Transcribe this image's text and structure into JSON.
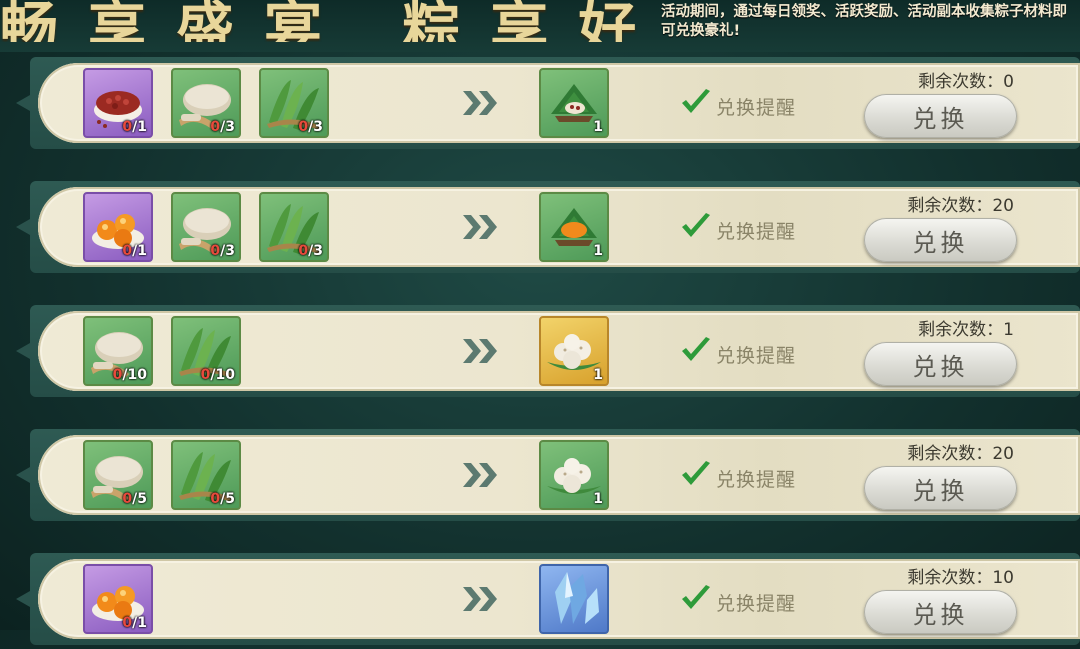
{
  "header": {
    "title": "畅享盛宴 粽享好礼",
    "description": "活动期间，通过每日领奖、活跃奖励、活动副本收集粽子材料即可兑换豪礼!"
  },
  "rows": [
    {
      "materials": [
        {
          "icon": "red-bean-bowl-icon",
          "rarity": "purple",
          "have": "0",
          "need": "1"
        },
        {
          "icon": "glutinous-rice-icon",
          "rarity": "green",
          "have": "0",
          "need": "3"
        },
        {
          "icon": "bamboo-leaves-icon",
          "rarity": "green",
          "have": "0",
          "need": "3"
        }
      ],
      "reward": {
        "icon": "red-bean-zongzi-icon",
        "rarity": "green",
        "count": "1"
      },
      "remind_label": "兑换提醒",
      "remaining": "剩余次数：0",
      "button_label": "兑换"
    },
    {
      "materials": [
        {
          "icon": "salted-egg-yolk-icon",
          "rarity": "purple",
          "have": "0",
          "need": "1"
        },
        {
          "icon": "glutinous-rice-icon",
          "rarity": "green",
          "have": "0",
          "need": "3"
        },
        {
          "icon": "bamboo-leaves-icon",
          "rarity": "green",
          "have": "0",
          "need": "3"
        }
      ],
      "reward": {
        "icon": "egg-yolk-zongzi-icon",
        "rarity": "green",
        "count": "1"
      },
      "remind_label": "兑换提醒",
      "remaining": "剩余次数：20",
      "button_label": "兑换"
    },
    {
      "materials": [
        {
          "icon": "glutinous-rice-icon",
          "rarity": "green",
          "have": "0",
          "need": "10"
        },
        {
          "icon": "bamboo-leaves-icon",
          "rarity": "green",
          "have": "0",
          "need": "10"
        }
      ],
      "reward": {
        "icon": "rice-dumplings-plate-icon",
        "rarity": "gold",
        "count": "1"
      },
      "remind_label": "兑换提醒",
      "remaining": "剩余次数：1",
      "button_label": "兑换"
    },
    {
      "materials": [
        {
          "icon": "glutinous-rice-icon",
          "rarity": "green",
          "have": "0",
          "need": "5"
        },
        {
          "icon": "bamboo-leaves-icon",
          "rarity": "green",
          "have": "0",
          "need": "5"
        }
      ],
      "reward": {
        "icon": "rice-dumplings-plate-icon",
        "rarity": "green",
        "count": "1"
      },
      "remind_label": "兑换提醒",
      "remaining": "剩余次数：20",
      "button_label": "兑换"
    },
    {
      "materials": [
        {
          "icon": "salted-egg-yolk-icon",
          "rarity": "purple",
          "have": "0",
          "need": "1"
        }
      ],
      "reward": {
        "icon": "blue-crystal-icon",
        "rarity": "blue",
        "count": ""
      },
      "remind_label": "兑换提醒",
      "remaining": "剩余次数：10",
      "button_label": "兑换"
    }
  ]
}
